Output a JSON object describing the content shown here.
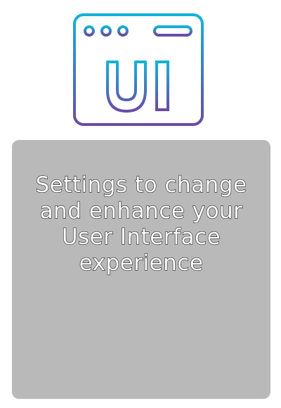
{
  "logo": {
    "icon": "ui-browser-window-icon",
    "glyph_text": "UI",
    "gradient_colors": [
      "#14b2d8",
      "#6a4aa6"
    ]
  },
  "card": {
    "background_color": "#b9b9b9",
    "text_color": "#ffffff",
    "description": "Settings to change and enhance your User Interface experience"
  }
}
